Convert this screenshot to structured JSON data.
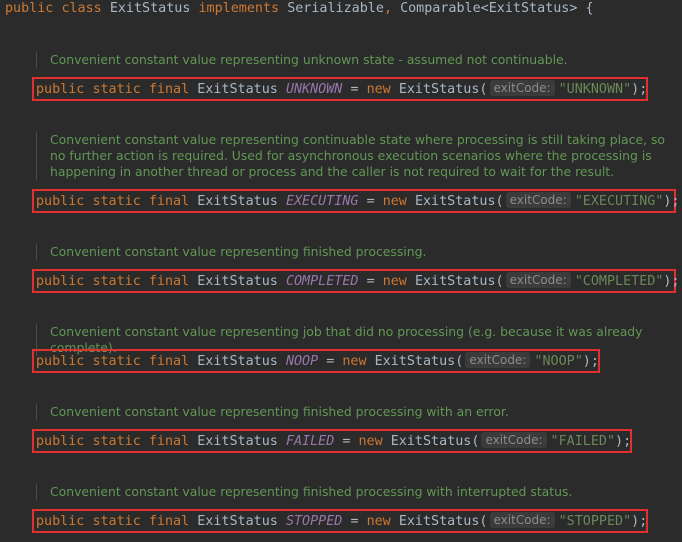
{
  "header": {
    "kw_public": "public",
    "kw_class": "class",
    "class_name": "ExitStatus",
    "kw_implements": "implements",
    "iface1": "Serializable",
    "comma": ",",
    "iface2": "Comparable<ExitStatus>",
    "brace": "{"
  },
  "decl": {
    "kw_public": "public",
    "kw_static": "static",
    "kw_final": "final",
    "type": "ExitStatus",
    "equals": "=",
    "kw_new": "new",
    "ctor": "ExitStatus(",
    "hint": "exitCode:",
    "close": ");"
  },
  "constants": [
    {
      "doc": "Convenient constant value representing unknown state - assumed not continuable.",
      "name": "UNKNOWN",
      "value": "\"UNKNOWN\""
    },
    {
      "doc": "Convenient constant value representing continuable state where processing is still taking place, so no further action is required. Used for asynchronous execution scenarios where the processing is happening in another thread or process and the caller is not required to wait for the result.",
      "name": "EXECUTING",
      "value": "\"EXECUTING\""
    },
    {
      "doc": "Convenient constant value representing finished processing.",
      "name": "COMPLETED",
      "value": "\"COMPLETED\""
    },
    {
      "doc": "Convenient constant value representing job that did no processing (e.g. because it was already complete).",
      "name": "NOOP",
      "value": "\"NOOP\""
    },
    {
      "doc": "Convenient constant value representing finished processing with an error.",
      "name": "FAILED",
      "value": "\"FAILED\""
    },
    {
      "doc": "Convenient constant value representing finished processing with interrupted status.",
      "name": "STOPPED",
      "value": "\"STOPPED\""
    }
  ],
  "colors": {
    "background": "#2b2b2b",
    "keyword": "#cc7832",
    "constant": "#9876aa",
    "string": "#6a8759",
    "doc": "#629755",
    "highlight_box": "#e03030"
  }
}
